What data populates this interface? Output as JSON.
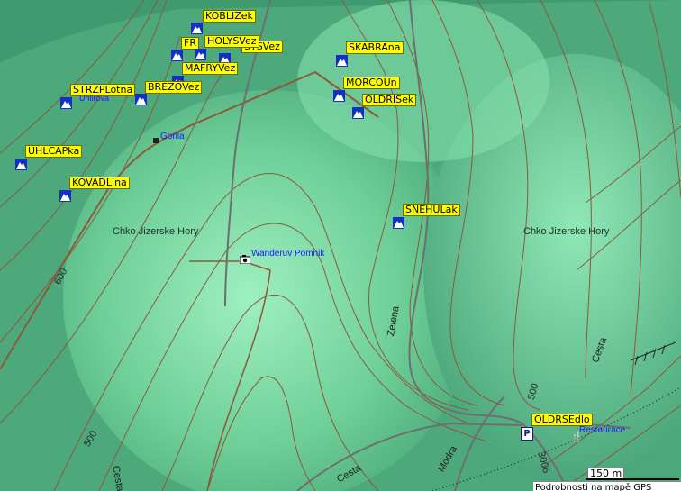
{
  "waypoints": [
    {
      "id": "kobliz",
      "label": "KOBLIZek"
    },
    {
      "id": "fr",
      "label": "FR"
    },
    {
      "id": "holys",
      "label": "HOLYSVez"
    },
    {
      "id": "sts",
      "label": "STSVez"
    },
    {
      "id": "mafry",
      "label": "MAFRYVez"
    },
    {
      "id": "strzp",
      "label": "STRZPLotna"
    },
    {
      "id": "brez",
      "label": "BREZOVez"
    },
    {
      "id": "skabr",
      "label": "SKABRAna"
    },
    {
      "id": "morco",
      "label": "MORCOUn"
    },
    {
      "id": "oldri",
      "label": "OLDRISek"
    },
    {
      "id": "uhlca",
      "label": "UHLCAPka"
    },
    {
      "id": "kovad",
      "label": "KOVADLina"
    },
    {
      "id": "snehu",
      "label": "SNEHULak"
    },
    {
      "id": "oldrse",
      "label": "OLDRSEdlo"
    }
  ],
  "places": {
    "region_left": "Chko Jizerske Hory",
    "region_right": "Chko Jizerske Hory",
    "gorila": "Gorila",
    "uhlirova": "Uhlirova",
    "wanderuv": "Wanderuv Pomnik",
    "restaurace": "Restaurace"
  },
  "roads": {
    "zelena": "Zelena",
    "cesta_right": "Cesta",
    "cesta_bottom": "Cesta",
    "cesta_left": "Cesta",
    "modra": "Modra"
  },
  "contours": {
    "c600": "600",
    "c500_left": "500",
    "c500_right": "500",
    "c3006": "3006"
  },
  "parking": "P",
  "scale": {
    "label": "150 m"
  },
  "footer": "Podrobnosti na mapě GPS",
  "colors": {
    "map_bg": "#3f9a6f",
    "highland": "#8fe2b2",
    "contour": "#8a5a3a",
    "trail": "#6e6e6e",
    "waypoint_label": "#ffff00",
    "poi_text": "#1a1aff"
  }
}
